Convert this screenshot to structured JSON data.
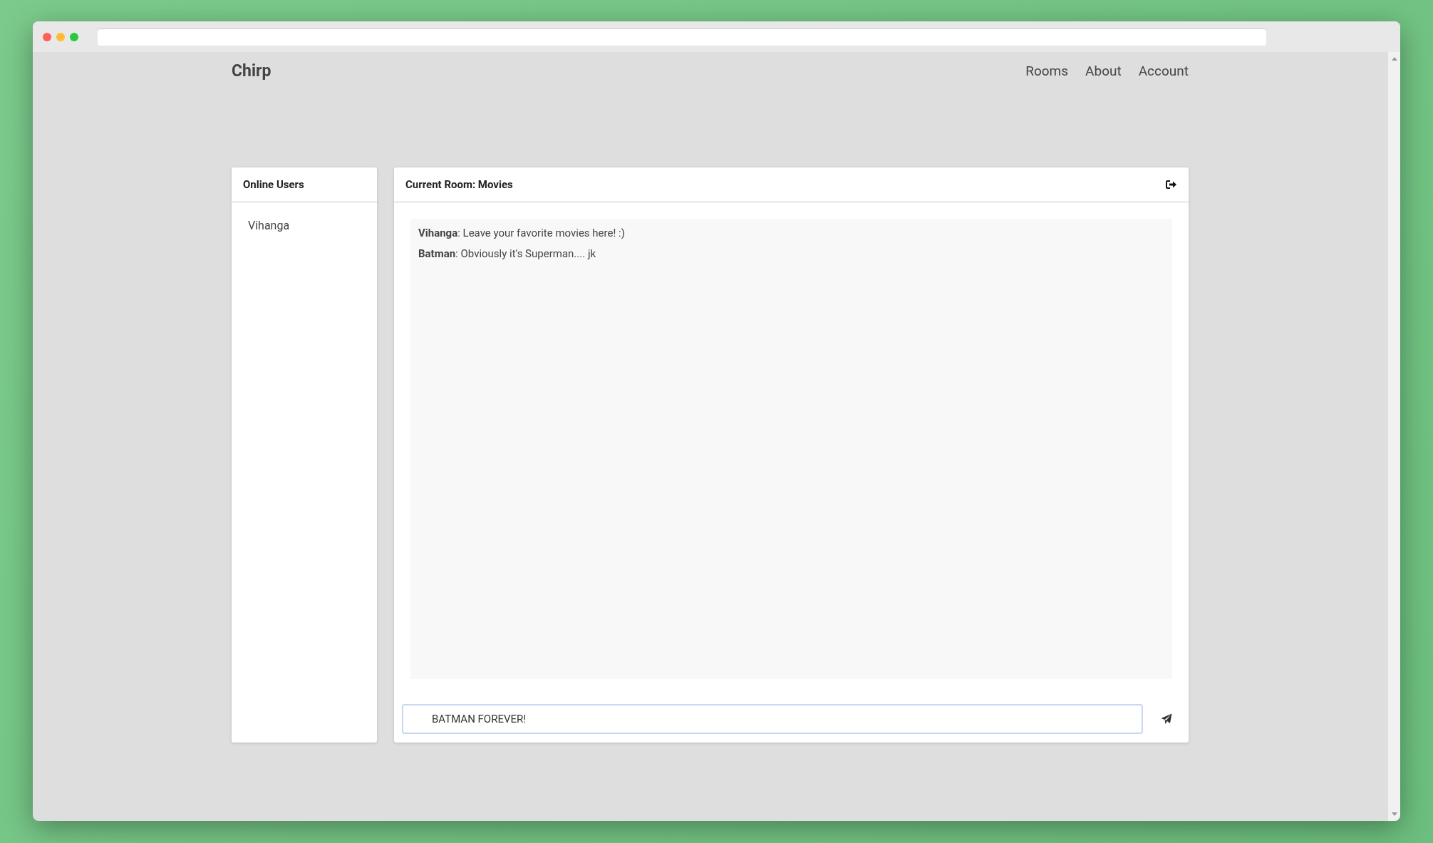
{
  "brand": "Chirp",
  "nav": [
    {
      "label": "Rooms"
    },
    {
      "label": "About"
    },
    {
      "label": "Account"
    }
  ],
  "users_panel": {
    "title": "Online Users",
    "users": [
      "Vihanga"
    ]
  },
  "chat_panel": {
    "title": "Current Room: Movies",
    "messages": [
      {
        "text": "**Vihanga**: Leave your favorite movies here! :)"
      },
      {
        "text": "**Batman**: Obviously it's Superman.... jk"
      }
    ],
    "input": {
      "value": "BATMAN FOREVER!"
    }
  }
}
